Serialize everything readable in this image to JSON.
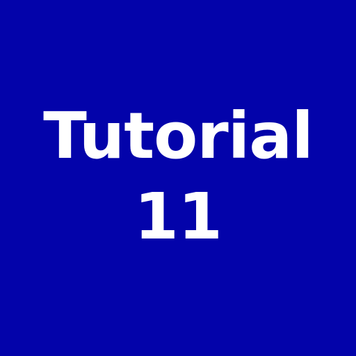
{
  "slide": {
    "title_line1": "Tutorial",
    "title_line2": "11",
    "background_color": "#0303AA",
    "text_color": "#FFFFFF"
  }
}
